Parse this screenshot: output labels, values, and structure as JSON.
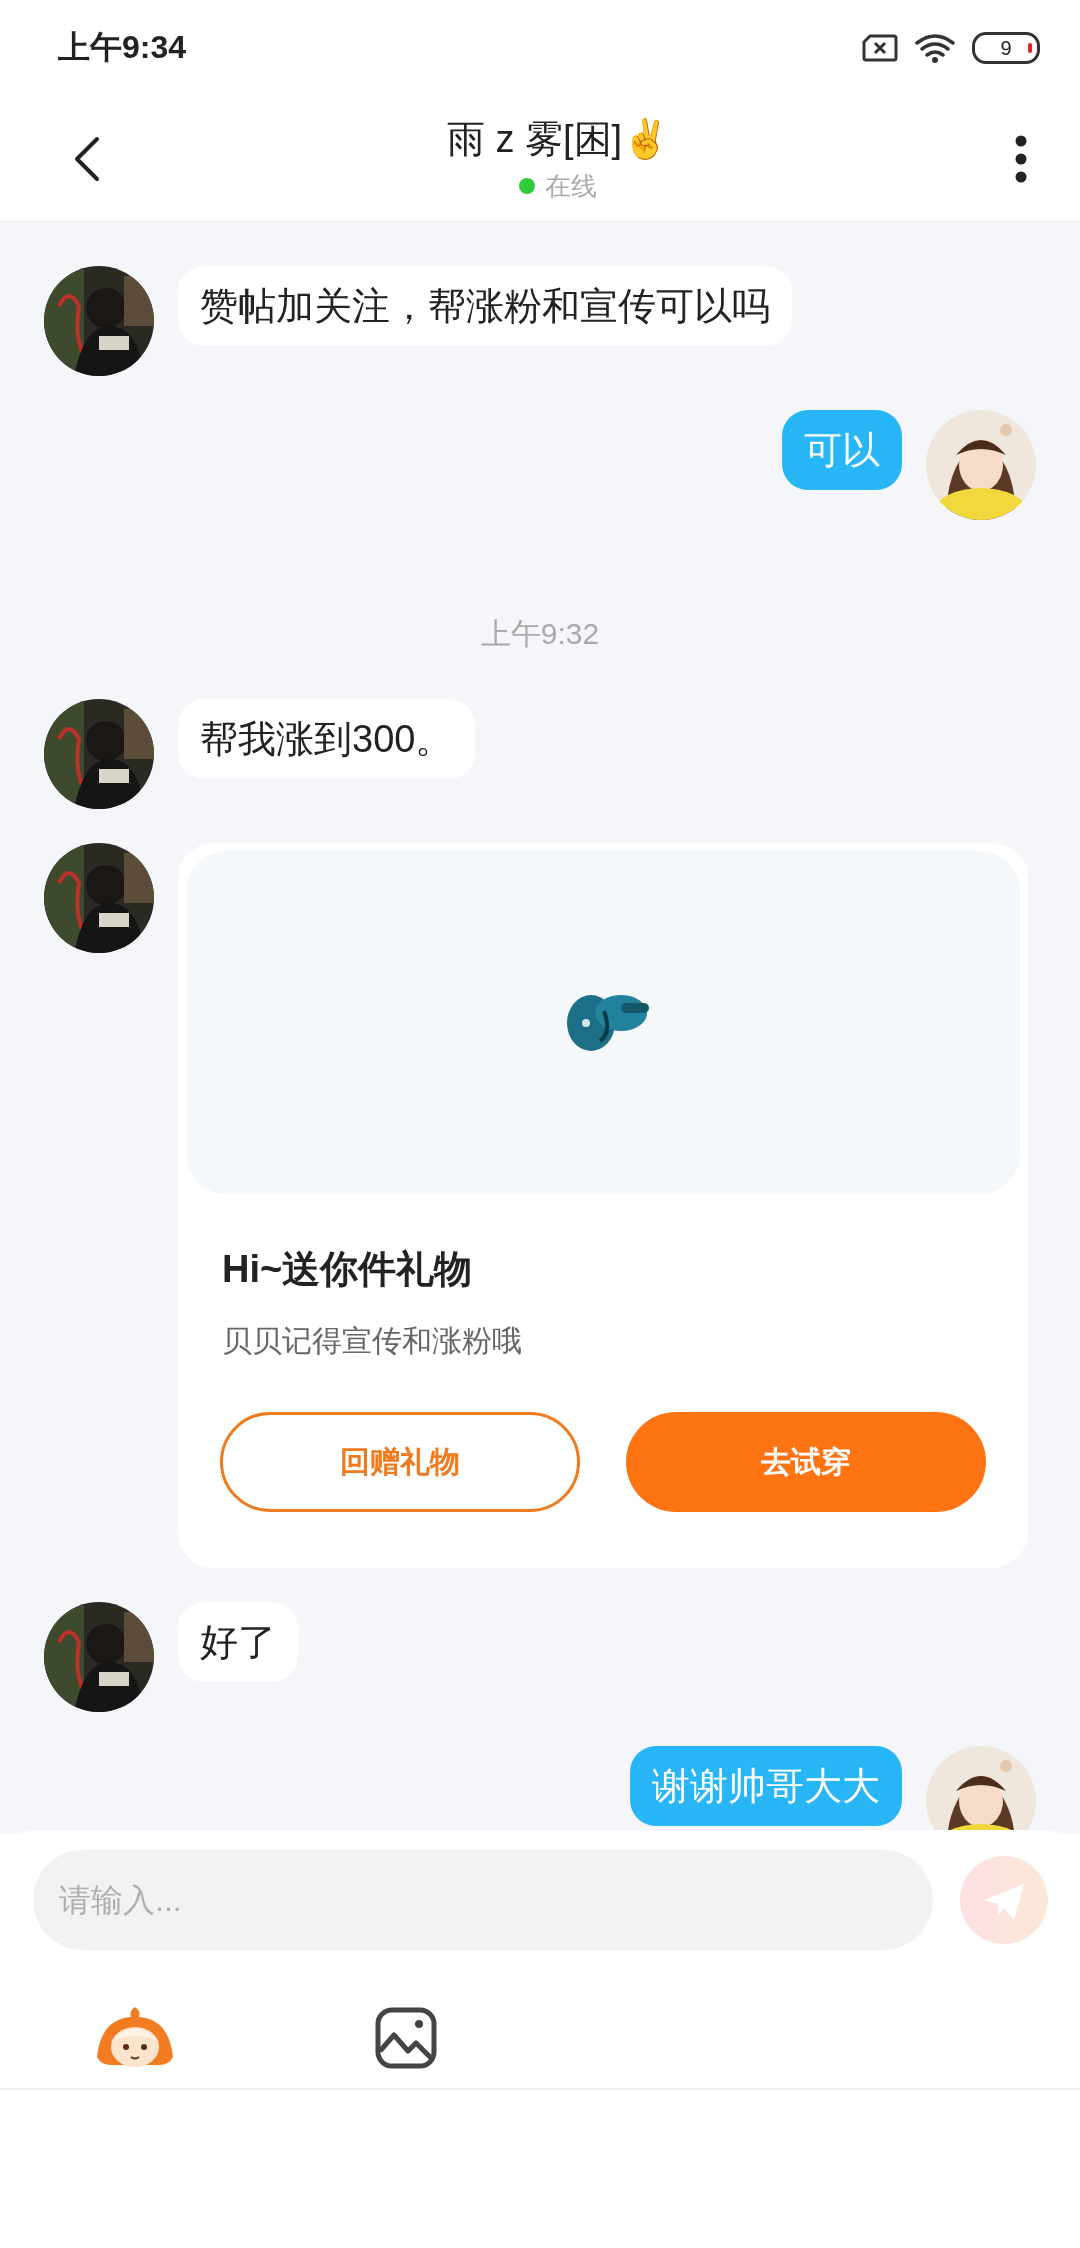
{
  "status_bar": {
    "time": "上午9:34",
    "battery": "9"
  },
  "header": {
    "title": "雨 z 雾[困]✌",
    "online": true,
    "status": "在线"
  },
  "messages": [
    {
      "kind": "incoming",
      "text": "赞帖加关注，帮涨粉和宣传可以吗"
    },
    {
      "kind": "outgoing",
      "text": "可以"
    },
    {
      "kind": "time",
      "text": "上午9:32"
    },
    {
      "kind": "incoming",
      "text": "帮我涨到300。"
    },
    {
      "kind": "gift",
      "title": "Hi~送你件礼物",
      "subtitle": "贝贝记得宣传和涨粉哦",
      "buttons": [
        {
          "kind": "outline",
          "label": "回赠礼物"
        },
        {
          "kind": "filled",
          "label": "去试穿"
        }
      ]
    },
    {
      "kind": "incoming",
      "text": "好了"
    },
    {
      "kind": "outgoing",
      "text": "谢谢帅哥大大"
    }
  ],
  "composer": {
    "placeholder": "请输入..."
  }
}
